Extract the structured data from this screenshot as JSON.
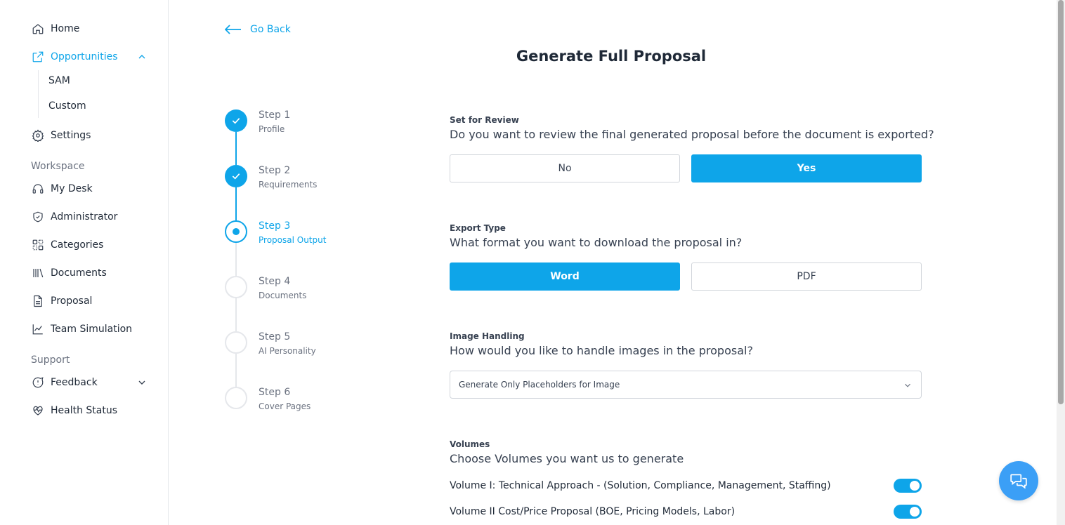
{
  "sidebar": {
    "home": "Home",
    "opportunities": "Opportunities",
    "sub": [
      "SAM",
      "Custom"
    ],
    "settings": "Settings",
    "workspace_label": "Workspace",
    "workspace": [
      "My Desk",
      "Administrator",
      "Categories",
      "Documents",
      "Proposal",
      "Team Simulation"
    ],
    "support_label": "Support",
    "feedback": "Feedback",
    "health": "Health Status"
  },
  "header": {
    "back": "Go Back",
    "title": "Generate Full Proposal"
  },
  "steps": [
    {
      "title": "Step 1",
      "sub": "Profile",
      "state": "done"
    },
    {
      "title": "Step 2",
      "sub": "Requirements",
      "state": "done"
    },
    {
      "title": "Step 3",
      "sub": "Proposal Output",
      "state": "current"
    },
    {
      "title": "Step 4",
      "sub": "Documents",
      "state": "todo"
    },
    {
      "title": "Step 5",
      "sub": "AI Personality",
      "state": "todo"
    },
    {
      "title": "Step 6",
      "sub": "Cover Pages",
      "state": "todo"
    }
  ],
  "review": {
    "label": "Set for Review",
    "question": "Do you want to review the final generated proposal before the document is exported?",
    "no": "No",
    "yes": "Yes",
    "selected": "Yes"
  },
  "export": {
    "label": "Export Type",
    "question": "What format you want to download the proposal in?",
    "word": "Word",
    "pdf": "PDF",
    "selected": "Word"
  },
  "images": {
    "label": "Image Handling",
    "question": "How would you like to handle images in the proposal?",
    "value": "Generate Only Placeholders for Image"
  },
  "volumes": {
    "label": "Volumes",
    "question": "Choose Volumes you want us to generate",
    "items": [
      {
        "label": "Volume I: Technical Approach - (Solution, Compliance, Management, Staffing)",
        "enabled": true
      },
      {
        "label": "Volume II Cost/Price Proposal (BOE, Pricing Models, Labor)",
        "enabled": true
      }
    ]
  },
  "colors": {
    "accent": "#0ea5e9"
  }
}
